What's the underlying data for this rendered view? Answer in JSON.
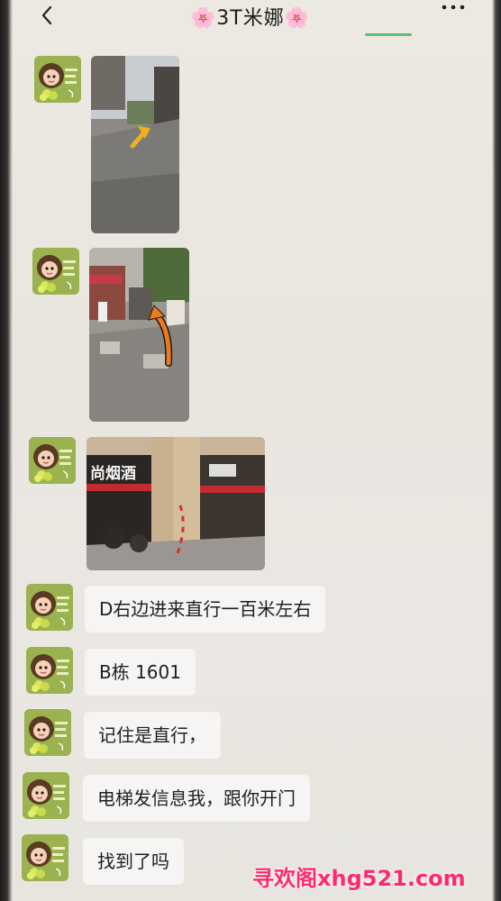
{
  "header": {
    "title": "🌸3T米娜🌸",
    "back_icon": "chevron-left-icon",
    "more_icon": "more-dots-icon"
  },
  "messages": [
    {
      "type": "image",
      "content": "street-photo-with-arrow"
    },
    {
      "type": "image",
      "content": "alley-photo-with-arrow"
    },
    {
      "type": "image",
      "content": "storefront-photo",
      "sign_left": "尚烟酒"
    },
    {
      "type": "text",
      "text": "D右边进来直行一百米左右"
    },
    {
      "type": "text",
      "text": "B栋 1601"
    },
    {
      "type": "text",
      "text": "记住是直行，"
    },
    {
      "type": "text",
      "text": "电梯发信息我，跟你开门"
    },
    {
      "type": "text",
      "text": "找到了吗"
    }
  ],
  "watermark": "寻欢阁xhg521.com",
  "colors": {
    "background": "#ebe8e2",
    "bubble": "#f6f5f3",
    "avatar_bg": "#9ab24f",
    "accent_green": "#58c26a",
    "arrow_orange": "#f07a1a",
    "watermark": "#ff2a6e"
  }
}
